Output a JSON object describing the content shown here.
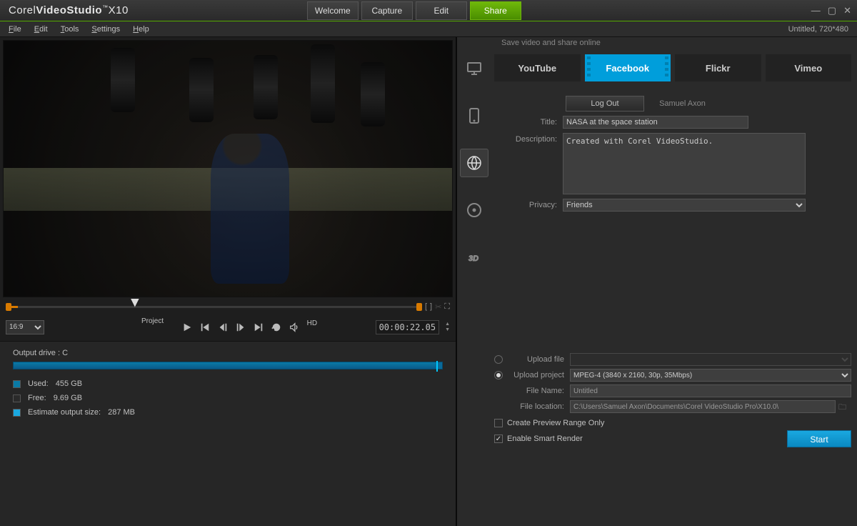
{
  "app": {
    "brand_thin": "Corel",
    "brand_bold": "VideoStudio",
    "brand_x10": "X10"
  },
  "main_tabs": {
    "welcome": "Welcome",
    "capture": "Capture",
    "edit": "Edit",
    "share": "Share"
  },
  "menu": {
    "file": "File",
    "edit": "Edit",
    "tools": "Tools",
    "settings": "Settings",
    "help": "Help"
  },
  "project_info": "Untitled, 720*480",
  "aspect": "16:9",
  "controls_label": "Project",
  "hd": "HD",
  "timecode": "00:00:22.05",
  "drive": {
    "title": "Output drive : C",
    "used_label": "Used:",
    "used_val": "455 GB",
    "free_label": "Free:",
    "free_val": "9.69 GB",
    "est_label": "Estimate output size:",
    "est_val": "287 MB"
  },
  "share": {
    "header": "Save video and share online",
    "services": {
      "youtube": "YouTube",
      "facebook": "Facebook",
      "flickr": "Flickr",
      "vimeo": "Vimeo"
    },
    "logout": "Log Out",
    "user": "Samuel Axon",
    "title_label": "Title:",
    "title_value": "NASA at the space station",
    "desc_label": "Description:",
    "desc_value": "Created with Corel VideoStudio.",
    "privacy_label": "Privacy:",
    "privacy_value": "Friends",
    "upload_file_label": "Upload file",
    "upload_project_label": "Upload project",
    "upload_project_value": "MPEG-4 (3840 x 2160, 30p, 35Mbps)",
    "filename_label": "File Name:",
    "filename_value": "Untitled",
    "location_label": "File location:",
    "location_value": "C:\\Users\\Samuel Axon\\Documents\\Corel VideoStudio Pro\\X10.0\\",
    "preview_range": "Create Preview Range Only",
    "smart_render": "Enable Smart Render",
    "start": "Start"
  }
}
